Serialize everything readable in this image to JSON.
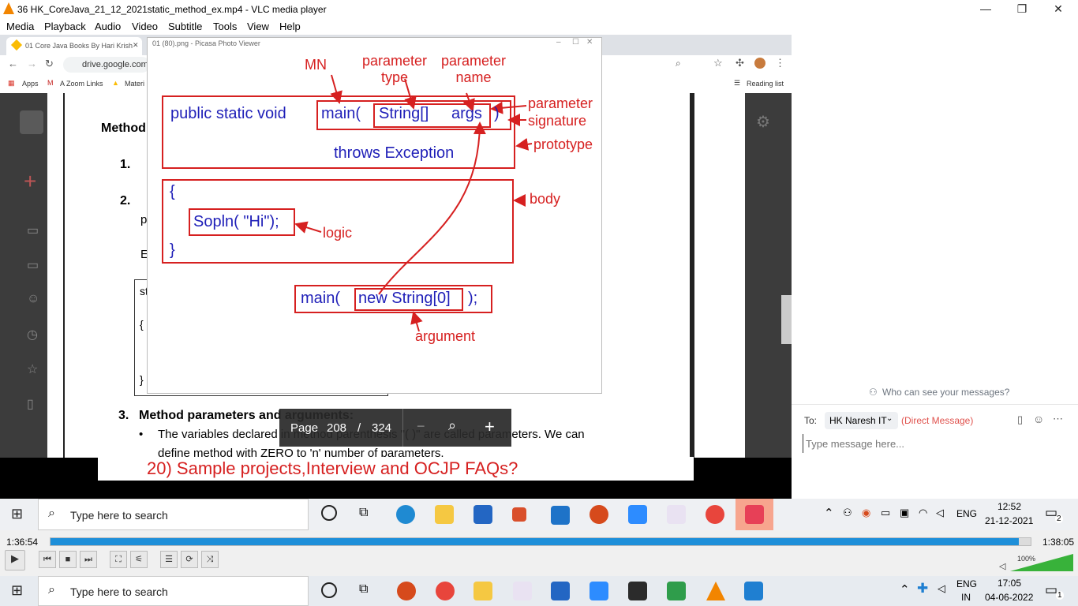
{
  "window": {
    "title": "36 HK_CoreJava_21_12_2021static_method_ex.mp4 - VLC media player"
  },
  "menu": [
    "Media",
    "Playback",
    "Audio",
    "Video",
    "Subtitle",
    "Tools",
    "View",
    "Help"
  ],
  "chrome": {
    "tab1": "01 Core Java Books By Hari Krish",
    "url": "drive.google.com",
    "bookmarks": [
      "Apps",
      "A Zoom Links",
      "Materi"
    ],
    "reading_list": "Reading list"
  },
  "picasa": {
    "title": "01 (80).png - Picasa Photo Viewer"
  },
  "diagram": {
    "mn": "MN",
    "param_type": "parameter\ntype",
    "param_name": "parameter\nname",
    "public_static_void": "public  static void",
    "main_open": "main(",
    "string_arr": "String[]",
    "args": "args",
    "close_paren": ")",
    "param_sig": "parameter\nsignature",
    "throws": "throws Exception",
    "prototype": "prototype",
    "brace_open": "{",
    "sopln": "Sopln( \"Hi\");",
    "logic": "logic",
    "brace_close": "}",
    "body": "body",
    "main_call": "main(",
    "new_string": "new String[0]",
    "call_close": ");",
    "argument": "argument"
  },
  "document": {
    "method": "Method",
    "item1": "1.",
    "item2": "2.",
    "item3": "3.",
    "item3_title": "Method parameters and arguments:",
    "bullet_text": "The variables declared in method parenthesis \"( )\" are called parameters. We can",
    "bullet_text2": "define method with ZERO to 'n' number of parameters.",
    "frag_p": "p",
    "frag_e": "E",
    "frag_st": "st",
    "frag_brace_open": "{",
    "frag_brace_close": "}"
  },
  "viewer": {
    "page_label": "Page",
    "page": "208",
    "sep": "/",
    "total": "324"
  },
  "caption": "20)  Sample projects,Interview and OCJP FAQs?",
  "chat": {
    "who": "Who can see your messages?",
    "to_label": "To:",
    "recipient": "HK Naresh IT",
    "direct": "(Direct Message)",
    "placeholder": "Type message here..."
  },
  "taskbar_inner": {
    "search": "Type here to search",
    "lang": "ENG",
    "time": "12:52",
    "date": "21-12-2021",
    "notif": "2"
  },
  "vlc": {
    "elapsed": "1:36:54",
    "total": "1:38:05",
    "progress": 0.988,
    "volume": "100%"
  },
  "taskbar_outer": {
    "search": "Type here to search",
    "lang1": "ENG",
    "lang2": "IN",
    "time": "17:05",
    "date": "04-06-2022",
    "notif": "1"
  }
}
